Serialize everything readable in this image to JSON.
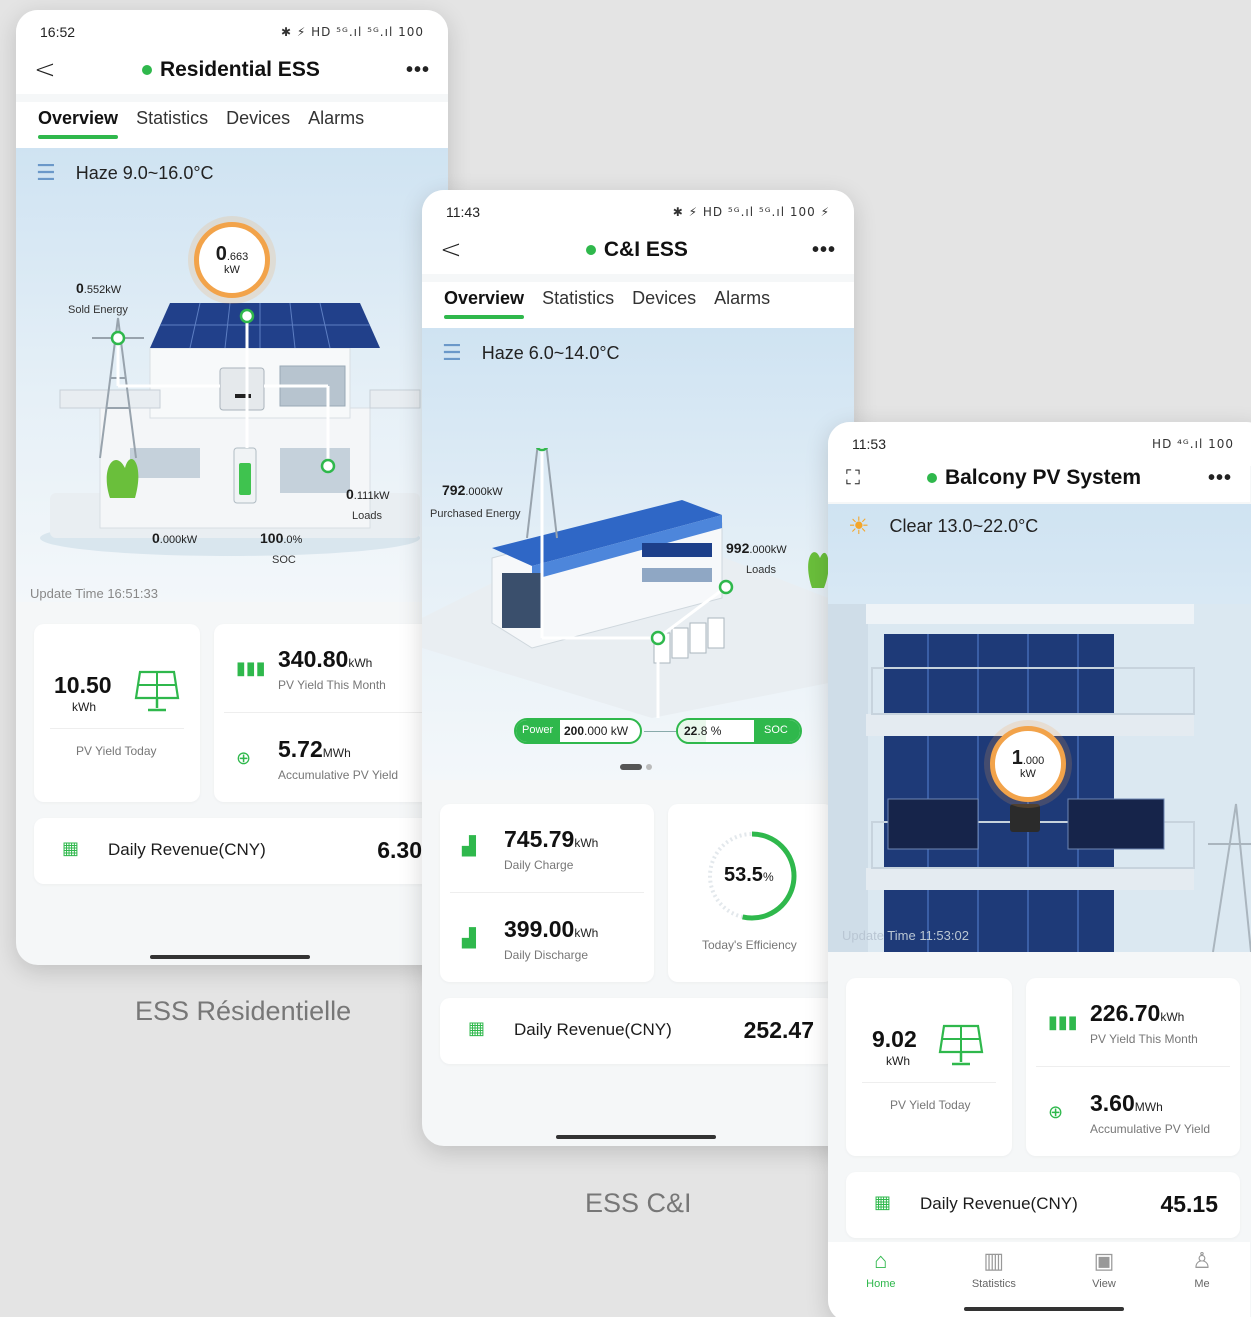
{
  "phones": {
    "residential": {
      "time": "16:52",
      "status_icons": "✱ ⚡ HD ⁵ᴳ.ıl ⁵ᴳ.ıl 100",
      "back": "<",
      "title": "Residential ESS",
      "more": "•••",
      "tabs": [
        "Overview",
        "Statistics",
        "Devices",
        "Alarms"
      ],
      "weather_icon": "haze-icon",
      "weather": "Haze 9.0~16.0°C",
      "gauge_value": "0",
      "gauge_decimal": ".663",
      "gauge_unit": "kW",
      "sold_value": "0",
      "sold_decimal": ".552kW",
      "sold_label": "Sold Energy",
      "loads_value": "0",
      "loads_decimal": ".111kW",
      "loads_label": "Loads",
      "battery_power_value": "0",
      "battery_power_decimal": ".000kW",
      "soc_value": "100",
      "soc_decimal": ".0%",
      "soc_label": "SOC",
      "update_time": "Update Time 16:51:33",
      "pv_today_value": "10.50",
      "pv_today_unit": "kWh",
      "pv_today_label": "PV Yield Today",
      "pv_month_value": "340.80",
      "pv_month_unit": "kWh",
      "pv_month_label": "PV Yield This Month",
      "pv_acc_value": "5.72",
      "pv_acc_unit": "MWh",
      "pv_acc_label": "Accumulative PV Yield",
      "revenue_label": "Daily Revenue(CNY)",
      "revenue_value": "6.30"
    },
    "ci": {
      "time": "11:43",
      "status_icons": "✱ ⚡ HD ⁵ᴳ.ıl ⁵ᴳ.ıl 100 ⚡",
      "back": "<",
      "title": "C&I ESS",
      "more": "•••",
      "tabs": [
        "Overview",
        "Statistics",
        "Devices",
        "Alarms"
      ],
      "weather": "Haze 6.0~14.0°C",
      "purchased_value": "792",
      "purchased_decimal": ".000kW",
      "purchased_label": "Purchased Energy",
      "loads_value": "992",
      "loads_decimal": ".000kW",
      "loads_label": "Loads",
      "power_label": "Power",
      "power_value": "200",
      "power_decimal": ".000 kW",
      "soc_value": "22",
      "soc_decimal": ".8 %",
      "soc_label": "SOC",
      "soc_fraction": 0.228,
      "charge_value": "745.79",
      "charge_unit": "kWh",
      "charge_label": "Daily Charge",
      "discharge_value": "399.00",
      "discharge_unit": "kWh",
      "discharge_label": "Daily Discharge",
      "efficiency_value": "53.5",
      "efficiency_unit": "%",
      "efficiency_fraction": 0.535,
      "efficiency_label": "Today's Efficiency",
      "revenue_label": "Daily Revenue(CNY)",
      "revenue_value": "252.47"
    },
    "balcony": {
      "time": "11:53",
      "status_icons": "HD ⁴ᴳ.ıl 100",
      "title": "Balcony PV System",
      "more": "•••",
      "weather": "Clear 13.0~22.0°C",
      "gauge_value": "1",
      "gauge_decimal": ".000",
      "gauge_unit": "kW",
      "update_time": "Update Time 11:53:02",
      "pv_today_value": "9.02",
      "pv_today_unit": "kWh",
      "pv_today_label": "PV Yield Today",
      "pv_month_value": "226.70",
      "pv_month_unit": "kWh",
      "pv_month_label": "PV Yield This Month",
      "pv_acc_value": "3.60",
      "pv_acc_unit": "MWh",
      "pv_acc_label": "Accumulative PV Yield",
      "revenue_label": "Daily Revenue(CNY)",
      "revenue_value": "45.15",
      "bottom_nav": [
        "Home",
        "Statistics",
        "View",
        "Me"
      ]
    }
  },
  "captions": {
    "residential": "ESS Résidentielle",
    "ci": "ESS C&I"
  },
  "colors": {
    "accent": "#2fb84c",
    "gauge": "#f2a34a",
    "background": "#e4e4e4"
  }
}
